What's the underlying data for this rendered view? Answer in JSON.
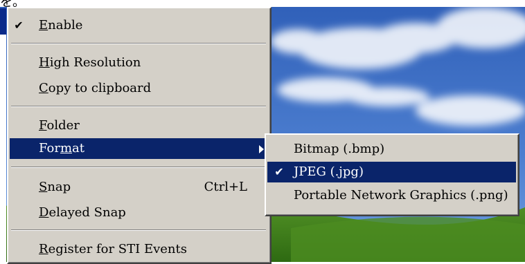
{
  "desktop": {
    "corner_glyph": "を。"
  },
  "main_menu": {
    "items": [
      {
        "pre": "",
        "key": "E",
        "post": "nable",
        "checked": true,
        "check": "✔"
      },
      {
        "pre": "",
        "key": "H",
        "post": "igh Resolution"
      },
      {
        "pre": "",
        "key": "C",
        "post": "opy to clipboard"
      },
      {
        "pre": "",
        "key": "F",
        "post": "older"
      },
      {
        "pre": "For",
        "key": "m",
        "post": "at",
        "selected": true
      },
      {
        "pre": "",
        "key": "S",
        "post": "nap",
        "shortcut": "Ctrl+L"
      },
      {
        "pre": "",
        "key": "D",
        "post": "elayed Snap"
      },
      {
        "pre": "",
        "key": "R",
        "post": "egister for STI Events"
      }
    ]
  },
  "sub_menu": {
    "items": [
      {
        "label": "Bitmap (.bmp)"
      },
      {
        "label": "JPEG (.jpg)",
        "checked": true,
        "selected": true,
        "check": "✔"
      },
      {
        "label": "Portable Network Graphics  (.png)"
      }
    ]
  },
  "colors": {
    "menu_face": "#d4d0c8",
    "highlight": "#0a246a",
    "sky": "#3d6fc7",
    "grass": "#3a7d1a"
  }
}
